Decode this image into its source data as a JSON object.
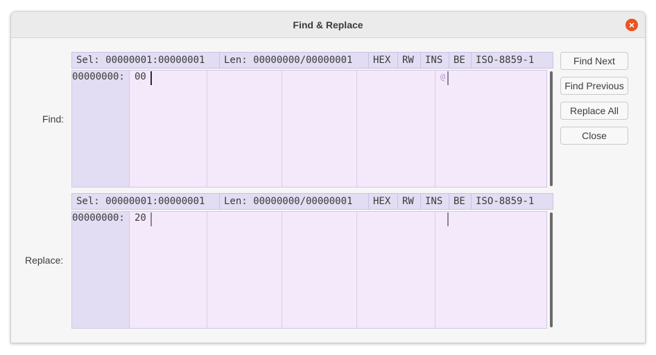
{
  "window": {
    "title": "Find & Replace"
  },
  "find": {
    "label": "Find:",
    "status": {
      "sel": "Sel: 00000001:00000001",
      "len": "Len: 00000000/00000001",
      "mode": "HEX",
      "rw": "RW",
      "ins": "INS",
      "endian": "BE",
      "encoding": "ISO-8859-1"
    },
    "address": "00000000:",
    "hex_value": "00",
    "ascii_value": "@"
  },
  "replace": {
    "label": "Replace:",
    "status": {
      "sel": "Sel: 00000001:00000001",
      "len": "Len: 00000000/00000001",
      "mode": "HEX",
      "rw": "RW",
      "ins": "INS",
      "endian": "BE",
      "encoding": "ISO-8859-1"
    },
    "address": "00000000:",
    "hex_value": "20",
    "ascii_value": ""
  },
  "buttons": {
    "find_next": "Find Next",
    "find_previous": "Find Previous",
    "replace_all": "Replace All",
    "close": "Close"
  },
  "icons": {
    "close": "close-icon"
  },
  "colors": {
    "close_button": "#e95420",
    "status_bar": "#e2ddf3",
    "hex_area": "#f4e8fb"
  }
}
